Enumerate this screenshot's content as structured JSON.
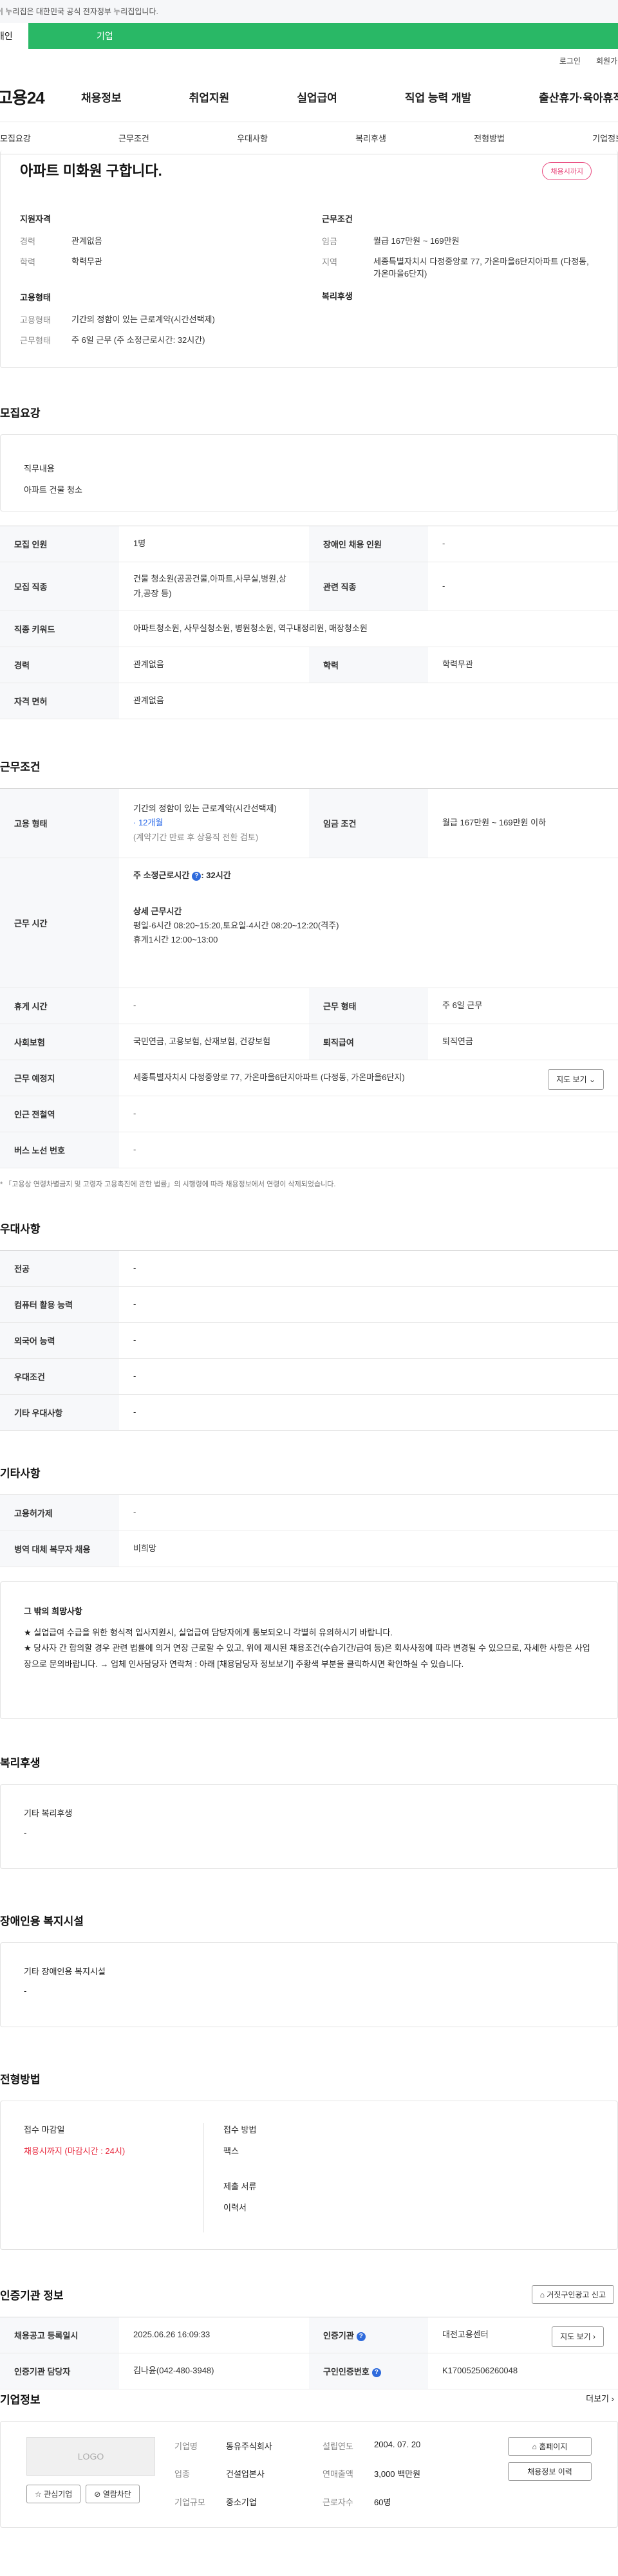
{
  "gov_banner": "이 누리집은 대한민국 공식 전자정부 누리집입니다.",
  "site_tabs": {
    "personal": "개인",
    "corporate": "기업"
  },
  "util": {
    "login": "로그인",
    "signup": "회원가입"
  },
  "logo": "고용24",
  "gnb": [
    "채용정보",
    "취업지원",
    "실업급여",
    "직업 능력 개발",
    "출산휴가·육아휴직"
  ],
  "subnav": [
    "모집요강",
    "근무조건",
    "우대사항",
    "복리후생",
    "전형방법",
    "기업정보"
  ],
  "job": {
    "title": "아파트 미화원 구합니다.",
    "status": "채용시까지",
    "qual_title": "지원자격",
    "qual": [
      {
        "k": "경력",
        "v": "관계없음"
      },
      {
        "k": "학력",
        "v": "학력무관"
      }
    ],
    "emp_title": "고용형태",
    "emp": [
      {
        "k": "고용형태",
        "v": "기간의 정함이 있는 근로계약(시간선택제)"
      },
      {
        "k": "근무형태",
        "v": "주 6일 근무 (주 소정근로시간: 32시간)"
      }
    ],
    "cond_title": "근무조건",
    "cond": [
      {
        "k": "임금",
        "v": "월급 167만원 ~ 169만원"
      },
      {
        "k": "지역",
        "v": "세종특별자치시 다정중앙로 77, 가온마을6단지아파트 (다정동, 가온마을6단지)"
      }
    ],
    "welfare_title": "복리후생"
  },
  "recruit": {
    "title": "모집요강",
    "duty_label": "직무내용",
    "duty_value": "아파트 건물 청소",
    "rows": {
      "count_k": "모집 인원",
      "count_v": "1명",
      "disabled_k": "장애인 채용 인원",
      "disabled_v": "-",
      "job_k": "모집 직종",
      "job_v": "건물 청소원(공공건물,아파트,사무실,병원,상가,공장 등)",
      "related_k": "관련 직종",
      "related_v": "-",
      "keyword_k": "직종 키워드",
      "keyword_v": "아파트청소원, 사무실청소원, 병원청소원, 역구내정리원, 매장청소원",
      "career_k": "경력",
      "career_v": "관계없음",
      "edu_k": "학력",
      "edu_v": "학력무관",
      "license_k": "자격 면허",
      "license_v": "관계없음"
    }
  },
  "work": {
    "title": "근무조건",
    "emp_k": "고용 형태",
    "emp_v1": "기간의 정함이 있는 근로계약(시간선택제)",
    "emp_v2": "· 12개월",
    "emp_v3": "(계약기간 만료 후 상용직 전환 검토)",
    "wage_k": "임금 조건",
    "wage_v": "월급 167만원 ~ 169만원 이하",
    "time_k": "근무 시간",
    "time_sum_label": "주 소정근로시간",
    "time_sum_value": ": 32시간",
    "time_detail_label": "상세 근무시간",
    "time_detail_1": "평일-6시간 08:20~15:20,토요일-4시간 08:20~12:20(격주)",
    "time_detail_2": "휴게1시간 12:00~13:00",
    "rest_k": "휴게 시간",
    "rest_v": "-",
    "type_k": "근무 형태",
    "type_v": "주 6일 근무",
    "ins_k": "사회보험",
    "ins_v": "국민연금, 고용보험, 산재보험, 건강보험",
    "retire_k": "퇴직급여",
    "retire_v": "퇴직연금",
    "place_k": "근무 예정지",
    "place_v": "세종특별자치시 다정중앙로 77, 가온마을6단지아파트 (다정동, 가온마을6단지)",
    "map_btn": "지도 보기",
    "station_k": "인근 전철역",
    "station_v": "-",
    "bus_k": "버스 노선 번호",
    "bus_v": "-",
    "note": "* 「고용상 연령차별금지 및 고령자 고용촉진에 관한 법률」의 시행령에 따라 채용정보에서 연령이 삭제되었습니다."
  },
  "pref": {
    "title": "우대사항",
    "rows": [
      {
        "k": "전공",
        "v": "-"
      },
      {
        "k": "컴퓨터 활용 능력",
        "v": "-"
      },
      {
        "k": "외국어 능력",
        "v": "-"
      },
      {
        "k": "우대조건",
        "v": "-"
      },
      {
        "k": "기타 우대사항",
        "v": "-"
      }
    ]
  },
  "etc": {
    "title": "기타사항",
    "rows": [
      {
        "k": "고용허가제",
        "v": "-"
      },
      {
        "k": "병역 대체 복무자 채용",
        "v": "비희망"
      }
    ],
    "wish_title": "그 밖의 희망사항",
    "wish_1": "★ 실업급여 수급을 위한 형식적 입사지원시, 실업급여 담당자에게 통보되오니 각별히 유의하시기 바랍니다.",
    "wish_2": "★ 당사자 간 합의할 경우 관련 법률에 의거 연장 근로할 수 있고, 위에 제시된 채용조건(수습기간/급여 등)은 회사사정에 따라 변경될 수 있으므로, 자세한 사항은 사업장으로 문의바랍니다. → 업체 인사담당자 연락처 : 아래 [채용담당자 정보보기] 주황색 부분을 클릭하시면 확인하실 수 있습니다."
  },
  "welfare": {
    "title": "복리후생",
    "label": "기타 복리후생",
    "value": "-"
  },
  "facility": {
    "title": "장애인용 복지시설",
    "label": "기타 장애인용 복지시설",
    "value": "-"
  },
  "process": {
    "title": "전형방법",
    "deadline_label": "접수 마감일",
    "deadline_value": "채용시까지 (마감시간 : 24시)",
    "method_label": "접수 방법",
    "method_value": "팩스",
    "docs_label": "제출 서류",
    "docs_value": "이력서"
  },
  "agency": {
    "title": "인증기관 정보",
    "report_btn": "거짓구인광고 신고",
    "reg_k": "채용공고 등록일시",
    "reg_v": "2025.06.26 16:09:33",
    "org_k": "인증기관",
    "org_v": "대전고용센터",
    "map_btn": "지도 보기",
    "staff_k": "인증기관 담당자",
    "staff_v": "김나윤(042-480-3948)",
    "no_k": "구인인증번호",
    "no_v": "K170052506260048"
  },
  "company": {
    "title": "기업정보",
    "more": "더보기",
    "logo": "LOGO",
    "interest_btn": "관심기업",
    "block_btn": "열람차단",
    "name_k": "기업명",
    "name_v": "동유주식회사",
    "founded_k": "설립연도",
    "founded_v": "2004. 07. 20",
    "industry_k": "업종",
    "industry_v": "건설업본사",
    "sales_k": "연매출액",
    "sales_v": "3,000 백만원",
    "size_k": "기업규모",
    "size_v": "중소기업",
    "emp_k": "근로자수",
    "emp_v": "60명",
    "home_btn": "홈페이지",
    "jobs_btn": "채용정보 이력"
  }
}
